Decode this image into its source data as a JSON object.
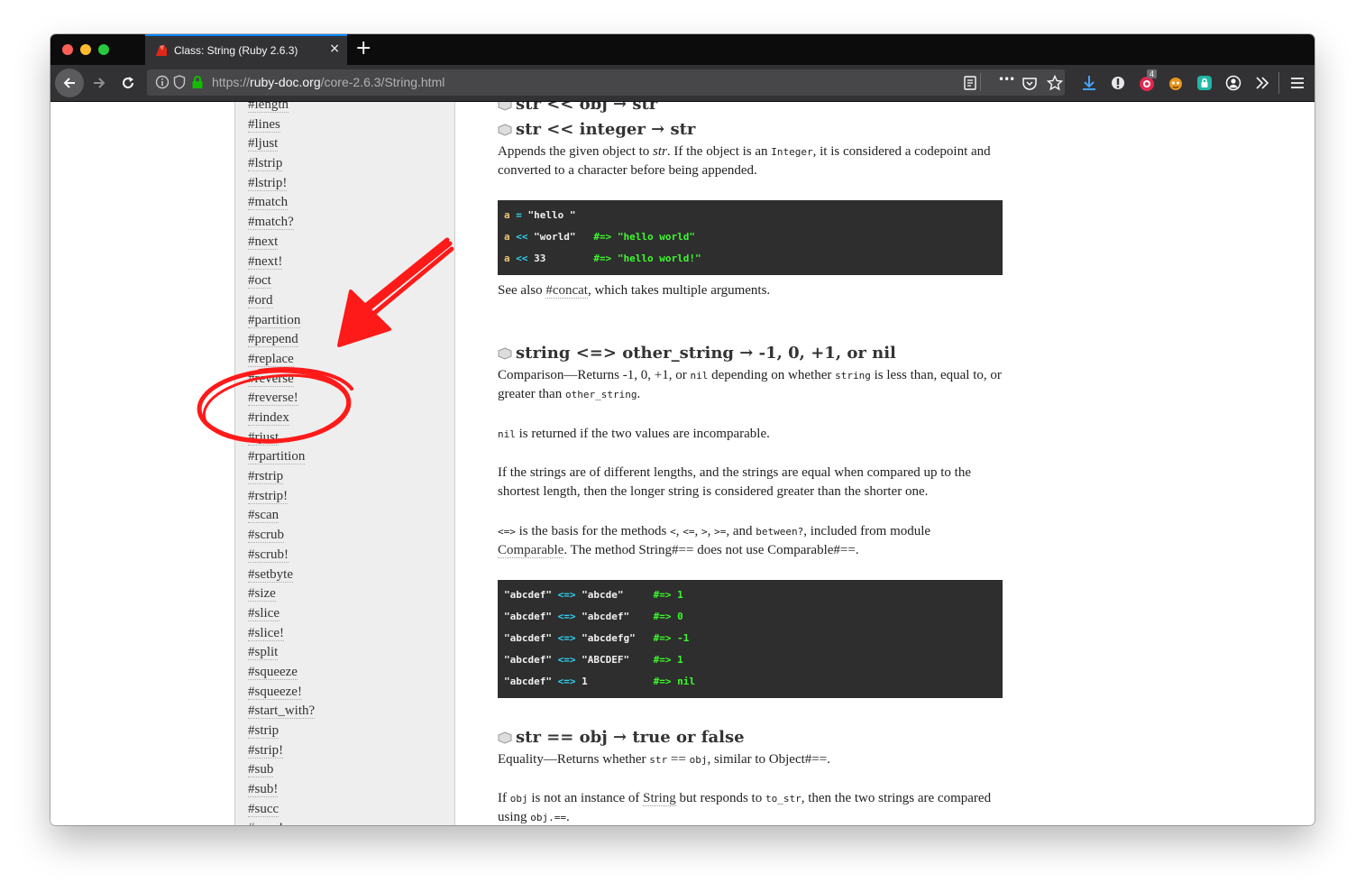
{
  "browser": {
    "tab_title": "Class: String (Ruby 2.6.3)",
    "tab_close": "×",
    "new_tab": "+",
    "url_prefix": "https://",
    "url_domain": "ruby-doc.org",
    "url_path": "/core-2.6.3/String.html",
    "overflow_menu": "•••",
    "extension_badge": "4"
  },
  "sidebar": {
    "items": [
      "#length",
      "#lines",
      "#ljust",
      "#lstrip",
      "#lstrip!",
      "#match",
      "#match?",
      "#next",
      "#next!",
      "#oct",
      "#ord",
      "#partition",
      "#prepend",
      "#replace",
      "#reverse",
      "#reverse!",
      "#rindex",
      "#rjust",
      "#rpartition",
      "#rstrip",
      "#rstrip!",
      "#scan",
      "#scrub",
      "#scrub!",
      "#setbyte",
      "#size",
      "#slice",
      "#slice!",
      "#split",
      "#squeeze",
      "#squeeze!",
      "#start_with?",
      "#strip",
      "#strip!",
      "#sub",
      "#sub!",
      "#succ",
      "#succ!"
    ]
  },
  "main": {
    "h1": "str << obj → str",
    "h2": "str << integer → str",
    "p1a": "Appends the given object to ",
    "p1b": "str",
    "p1c": ". If the object is an ",
    "p1d": "Integer",
    "p1e": ", it is considered a codepoint and converted to a character before being appended.",
    "code1": [
      {
        "a": "a",
        "b": " = ",
        "c": "\"hello \"",
        "d": "",
        "e": ""
      },
      {
        "a": "a",
        "b": " << ",
        "c": "\"world\"",
        "d": "   #=> ",
        "e": "\"hello world\""
      },
      {
        "a": "a",
        "b": " << ",
        "c": "33",
        "d": "        #=> ",
        "e": "\"hello world!\""
      }
    ],
    "p2a": "See also ",
    "p2b": "#concat",
    "p2c": ", which takes multiple arguments.",
    "h3": "string <=> other_string → -1, 0, +1, or nil",
    "p3a": "Comparison—Returns -1, 0, +1, or ",
    "p3b": "nil",
    "p3c": " depending on whether ",
    "p3d": "string",
    "p3e": " is less than, equal to, or greater than ",
    "p3f": "other_string",
    "p3g": ".",
    "p4a": "nil",
    "p4b": " is returned if the two values are incomparable.",
    "p5": "If the strings are of different lengths, and the strings are equal when compared up to the shortest length, then the longer string is considered greater than the shorter one.",
    "p6a": "<=>",
    "p6b": " is the basis for the methods ",
    "p6c": "<",
    "p6d": ", ",
    "p6e": "<=",
    "p6f": ", ",
    "p6g": ">",
    "p6h": ", ",
    "p6i": ">=",
    "p6j": ", and ",
    "p6k": "between?",
    "p6l": ", included from module ",
    "p6m": "Comparable",
    "p6n": ". The method String#== does not use Comparable#==.",
    "code2": [
      {
        "a": "\"abcdef\"",
        "b": " <=> ",
        "c": "\"abcde\"  ",
        "d": "   #=> ",
        "e": "1"
      },
      {
        "a": "\"abcdef\"",
        "b": " <=> ",
        "c": "\"abcdef\" ",
        "d": "   #=> ",
        "e": "0"
      },
      {
        "a": "\"abcdef\"",
        "b": " <=> ",
        "c": "\"abcdefg\"",
        "d": "   #=> ",
        "e": "-1"
      },
      {
        "a": "\"abcdef\"",
        "b": " <=> ",
        "c": "\"ABCDEF\" ",
        "d": "   #=> ",
        "e": "1"
      },
      {
        "a": "\"abcdef\"",
        "b": " <=> ",
        "c": "1        ",
        "d": "   #=> ",
        "e": "nil"
      }
    ],
    "h4": "str == obj → true or false",
    "p7a": "Equality—Returns whether ",
    "p7b": "str",
    "p7c": " == ",
    "p7d": "obj",
    "p7e": ", similar to Object#==.",
    "p8a": "If ",
    "p8b": "obj",
    "p8c": " is not an instance of ",
    "p8d": "String",
    "p8e": " but responds to ",
    "p8f": "to_str",
    "p8g": ", then the two strings are compared using ",
    "p8h": "obj.==",
    "p8i": "."
  },
  "colors": {
    "annotation": "#ff1a1a",
    "code_bg": "#2e2e2e",
    "code_cyan": "#31d4f2",
    "code_green": "#3dfa2d"
  }
}
